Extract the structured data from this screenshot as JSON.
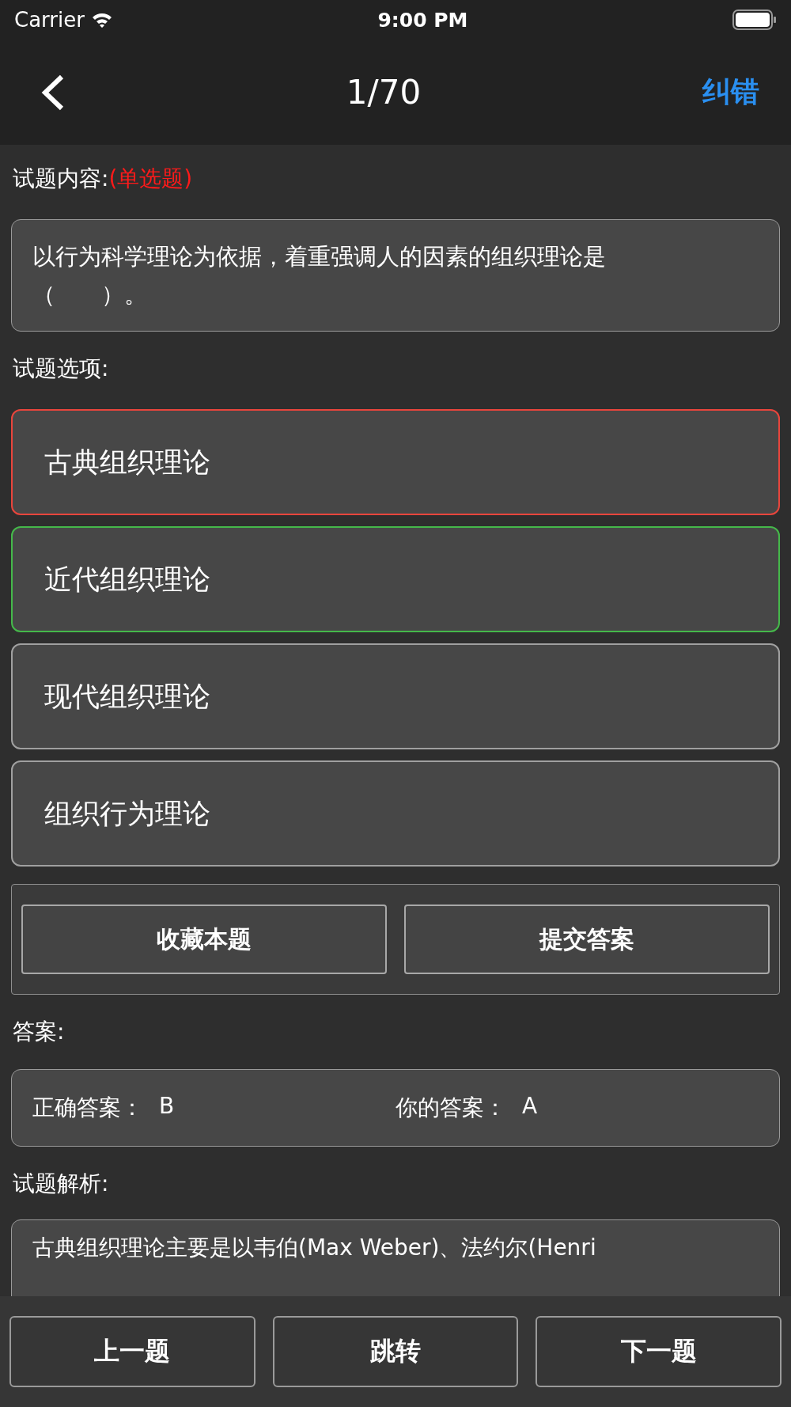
{
  "status_bar": {
    "carrier": "Carrier",
    "time": "9:00 PM"
  },
  "nav": {
    "title": "1/70",
    "action": "纠错"
  },
  "question": {
    "label": "试题内容:",
    "type": "(单选题)",
    "text": "以行为科学理论为依据，着重强调人的因素的组织理论是（　　）。"
  },
  "options_label": "试题选项:",
  "options": [
    {
      "text": "古典组织理论",
      "selected": true,
      "correct": false
    },
    {
      "text": "近代组织理论",
      "selected": false,
      "correct": true
    },
    {
      "text": "现代组织理论",
      "selected": false,
      "correct": false
    },
    {
      "text": "组织行为理论",
      "selected": false,
      "correct": false
    }
  ],
  "actions": [
    "收藏本题",
    "提交答案"
  ],
  "answer": {
    "label": "答案:",
    "correct_label": "正确答案：",
    "correct_value": "B",
    "yours_label": "你的答案：",
    "yours_value": "A"
  },
  "analysis": {
    "label": "试题解析:",
    "text": "古典组织理论主要是以韦伯(Max Weber)、法约尔(Henri"
  },
  "bottom_buttons": [
    "上一题",
    "跳转",
    "下一题"
  ]
}
